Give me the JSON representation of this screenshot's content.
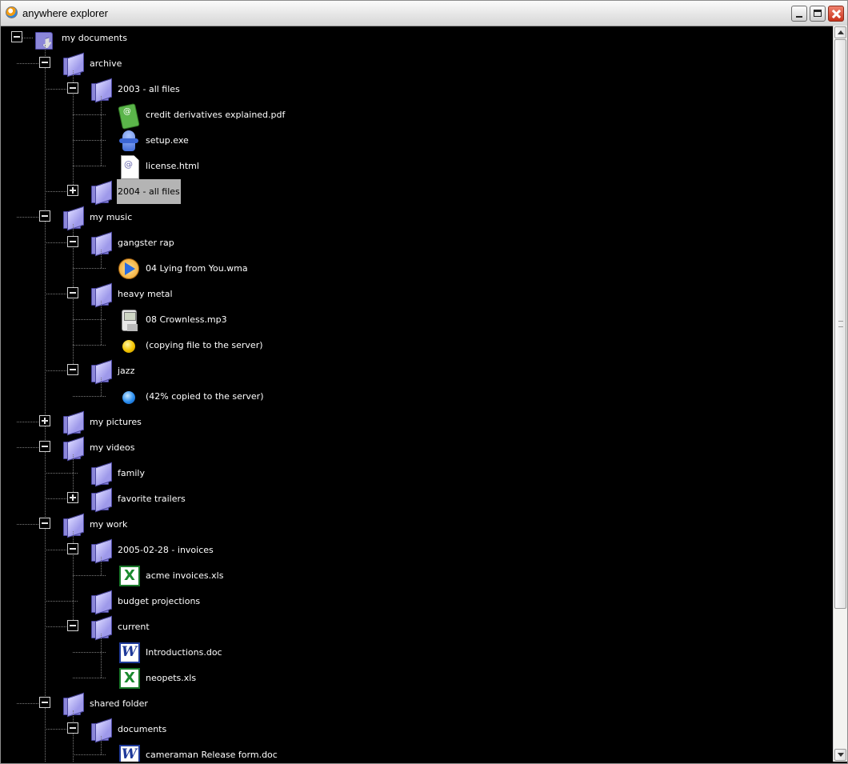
{
  "window": {
    "title": "anywhere explorer"
  },
  "tree": [
    {
      "depth": 0,
      "toggle": "minus",
      "icon": "folder-arrow",
      "label": "my documents",
      "lines": [],
      "conn": false
    },
    {
      "depth": 1,
      "toggle": "minus",
      "icon": "folder",
      "label": "archive"
    },
    {
      "depth": 2,
      "toggle": "minus",
      "icon": "folder",
      "label": "2003 - all files"
    },
    {
      "depth": 3,
      "toggle": null,
      "icon": "pdf",
      "label": "credit derivatives explained.pdf"
    },
    {
      "depth": 3,
      "toggle": null,
      "icon": "exe",
      "label": "setup.exe"
    },
    {
      "depth": 3,
      "toggle": null,
      "icon": "html",
      "label": "license.html"
    },
    {
      "depth": 2,
      "toggle": "plus",
      "icon": "folder",
      "label": "2004 - all files",
      "selected": true
    },
    {
      "depth": 1,
      "toggle": "minus",
      "icon": "folder",
      "label": "my music"
    },
    {
      "depth": 2,
      "toggle": "minus",
      "icon": "folder",
      "label": "gangster rap"
    },
    {
      "depth": 3,
      "toggle": null,
      "icon": "wma",
      "label": "04 Lying from You.wma"
    },
    {
      "depth": 2,
      "toggle": "minus",
      "icon": "folder",
      "label": "heavy metal"
    },
    {
      "depth": 3,
      "toggle": null,
      "icon": "mp3",
      "label": "08 Crownless.mp3"
    },
    {
      "depth": 3,
      "toggle": null,
      "icon": "dot-yellow",
      "label": "(copying file to the server)"
    },
    {
      "depth": 2,
      "toggle": "minus",
      "icon": "folder",
      "label": "jazz"
    },
    {
      "depth": 3,
      "toggle": null,
      "icon": "dot-blue",
      "label": "(42% copied to the server)"
    },
    {
      "depth": 1,
      "toggle": "plus",
      "icon": "folder",
      "label": "my pictures"
    },
    {
      "depth": 1,
      "toggle": "minus",
      "icon": "folder",
      "label": "my videos"
    },
    {
      "depth": 2,
      "toggle": null,
      "icon": "folder",
      "label": "family"
    },
    {
      "depth": 2,
      "toggle": "plus",
      "icon": "folder",
      "label": "favorite trailers"
    },
    {
      "depth": 1,
      "toggle": "minus",
      "icon": "folder",
      "label": "my work"
    },
    {
      "depth": 2,
      "toggle": "minus",
      "icon": "folder",
      "label": "2005-02-28 - invoices"
    },
    {
      "depth": 3,
      "toggle": null,
      "icon": "xls",
      "label": "acme invoices.xls"
    },
    {
      "depth": 2,
      "toggle": null,
      "icon": "folder",
      "label": "budget projections"
    },
    {
      "depth": 2,
      "toggle": "minus",
      "icon": "folder",
      "label": "current"
    },
    {
      "depth": 3,
      "toggle": null,
      "icon": "doc",
      "label": "Introductions.doc"
    },
    {
      "depth": 3,
      "toggle": null,
      "icon": "xls",
      "label": "neopets.xls"
    },
    {
      "depth": 1,
      "toggle": "minus",
      "icon": "folder",
      "label": "shared folder"
    },
    {
      "depth": 2,
      "toggle": "minus",
      "icon": "folder",
      "label": "documents"
    },
    {
      "depth": 3,
      "toggle": null,
      "icon": "doc",
      "label": "cameraman Release form.doc"
    }
  ]
}
